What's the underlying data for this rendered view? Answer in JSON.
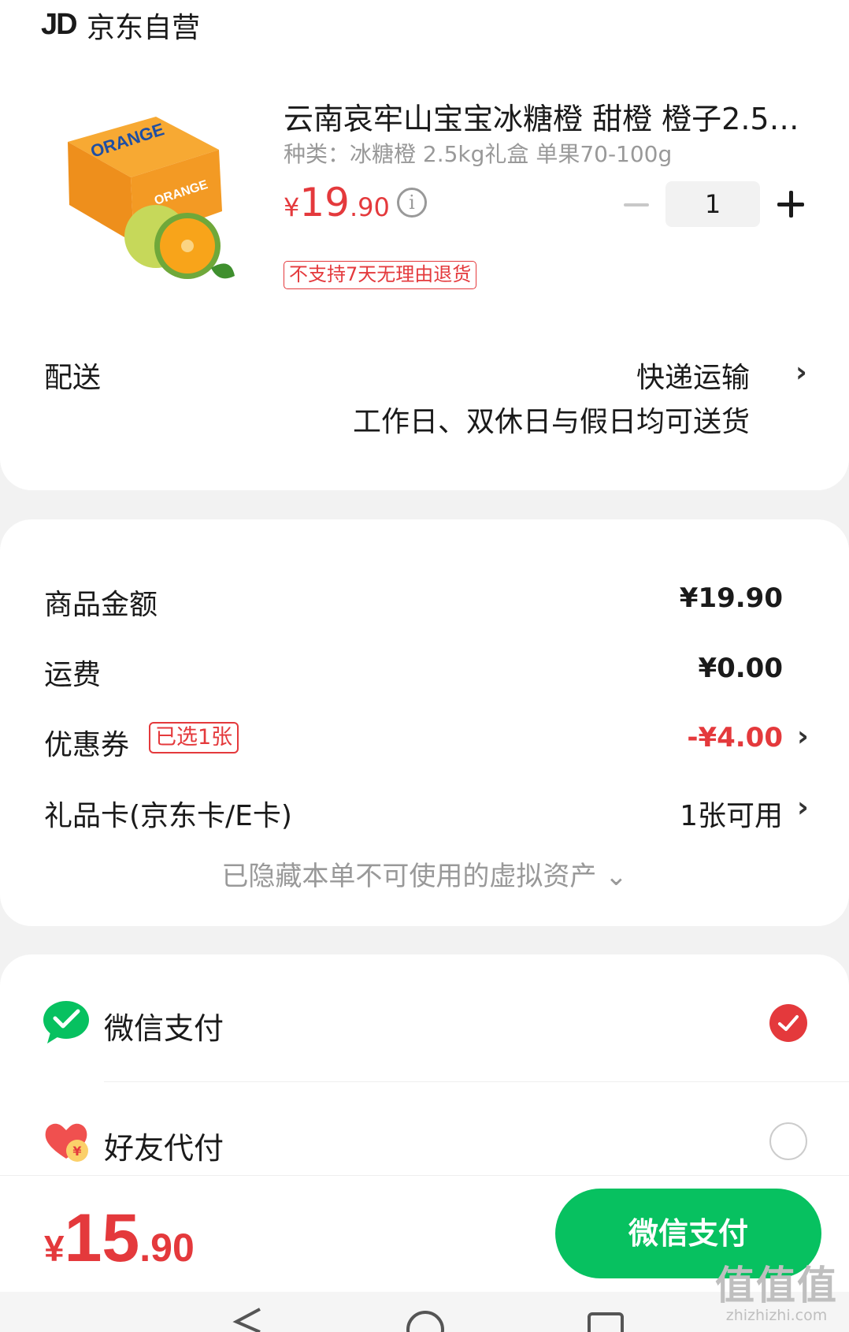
{
  "store": {
    "logo": "JD",
    "name": "京东自营"
  },
  "product": {
    "image_icon": "orange-gift-box-image",
    "title": "云南哀牢山宝宝冰糖橙 甜橙 橙子2.5kg礼盒 单果70-100g",
    "spec": "种类：冰糖橙 2.5kg礼盒 单果70-100g",
    "price": {
      "currency": "¥",
      "integer": "19",
      "decimal": ".90"
    },
    "quantity": "1",
    "return_policy": "不支持7天无理由退货"
  },
  "delivery": {
    "label": "配送",
    "method": "快递运输",
    "note": "工作日、双休日与假日均可送货"
  },
  "summary": {
    "goods_amount": {
      "label": "商品金额",
      "value": "¥19.90"
    },
    "shipping": {
      "label": "运费",
      "value": "¥0.00"
    },
    "coupon": {
      "label": "优惠券",
      "badge": "已选1张",
      "value": "-¥4.00"
    },
    "gift_card": {
      "label": "礼品卡(京东卡/E卡)",
      "value": "1张可用"
    },
    "hidden_assets": "已隐藏本单不可使用的虚拟资产 ⌄"
  },
  "payment": {
    "methods": [
      {
        "label": "微信支付",
        "icon": "wechat-pay-icon",
        "selected": true
      },
      {
        "label": "好友代付",
        "icon": "friend-pay-heart-icon",
        "selected": false
      }
    ]
  },
  "footer": {
    "total": {
      "currency": "¥",
      "integer": "15",
      "decimal": ".90"
    },
    "pay_button": "微信支付"
  },
  "watermark": {
    "main": "值值值",
    "sub": "zhizhizhi.com"
  },
  "colors": {
    "accent_red": "#e4393c",
    "wechat_green": "#07c160",
    "page_bg": "#f2f2f2"
  }
}
